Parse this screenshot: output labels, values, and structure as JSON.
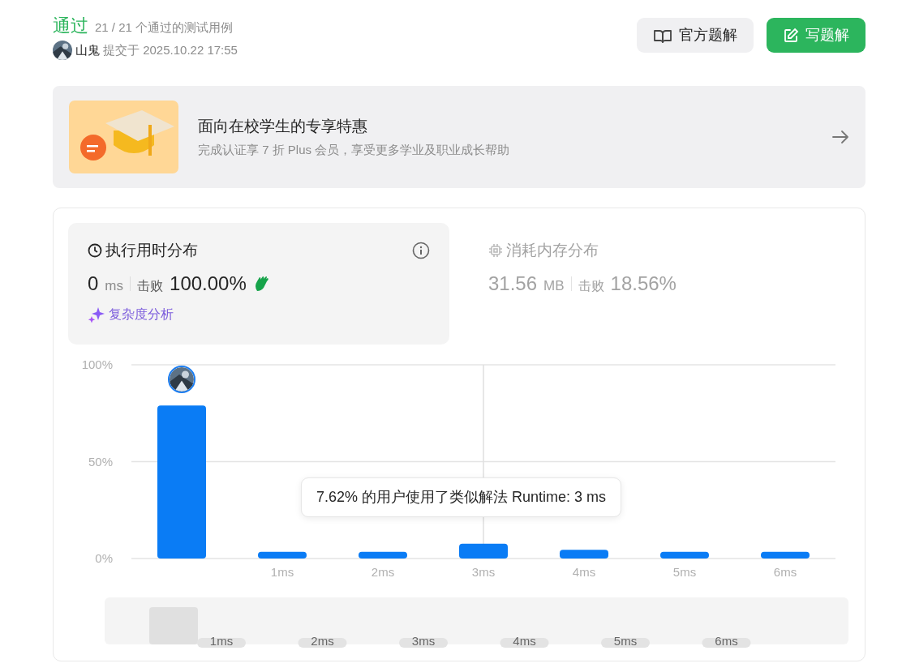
{
  "status": {
    "verdict": "通过",
    "cases": "21 / 21 个通过的测试用例"
  },
  "submitter": {
    "name": "山鬼",
    "submitted": "提交于 2025.10.22 17:55"
  },
  "buttons": [
    {
      "kind": "secondary",
      "label": "官方题解"
    },
    {
      "kind": "primary",
      "label": "写题解"
    }
  ],
  "banner": {
    "title": "面向在校学生的专享特惠",
    "subtitle": "完成认证享 7 折 Plus 会员，享受更多学业及职业成长帮助"
  },
  "stats": [
    {
      "kind": "runtime",
      "title": "执行用时分布",
      "value": "0",
      "unit": "ms",
      "beats_label": "击败",
      "beats": "100.00%",
      "selected": true,
      "analysis": "复杂度分析"
    },
    {
      "kind": "memory",
      "title": "消耗内存分布",
      "value": "31.56",
      "unit": "MB",
      "beats_label": "击败",
      "beats": "18.56%",
      "selected": false
    }
  ],
  "chart_data": {
    "type": "bar",
    "x": [
      0,
      1,
      2,
      3,
      4,
      5,
      6
    ],
    "xlim": [
      -0.5,
      6.5
    ],
    "xticks": [
      {
        "value": 1,
        "label": "1ms"
      },
      {
        "value": 2,
        "label": "2ms"
      },
      {
        "value": 3,
        "label": "3ms"
      },
      {
        "value": 4,
        "label": "4ms"
      },
      {
        "value": 5,
        "label": "5ms"
      },
      {
        "value": 6,
        "label": "6ms"
      }
    ],
    "ylim": [
      0,
      100
    ],
    "grid": true,
    "ref_lines": [
      {
        "axis": "x",
        "value": 3
      }
    ],
    "yticks": [
      {
        "value": 0,
        "label": "0%"
      },
      {
        "value": 50,
        "label": "50%"
      },
      {
        "value": 100,
        "label": "100%"
      }
    ],
    "series": [
      {
        "color": "#0a7cf5",
        "values": [
          79,
          3.5,
          3.5,
          7.6,
          4.5,
          3.5,
          3.5
        ]
      }
    ]
  },
  "tooltip": "7.62% 的用户使用了类似解法 Runtime: 3 ms",
  "overview_labels": [
    "1ms",
    "2ms",
    "3ms",
    "4ms",
    "5ms",
    "6ms"
  ]
}
